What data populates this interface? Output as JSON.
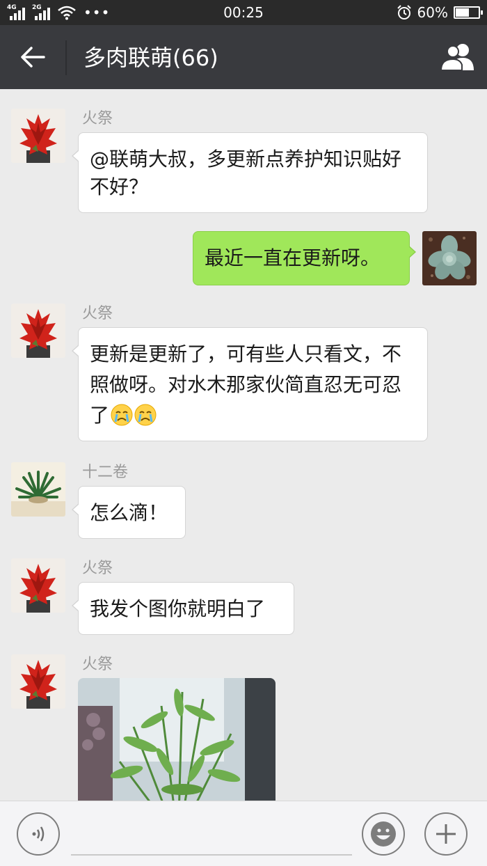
{
  "status_bar": {
    "network_1": "4G",
    "network_2": "2G",
    "more": "•••",
    "time": "00:25",
    "battery_text": "60%",
    "battery_level": 0.6
  },
  "header": {
    "title": "多肉联萌(66)",
    "back_icon": "back-arrow-icon",
    "members_icon": "group-members-icon"
  },
  "messages": [
    {
      "direction": "incoming",
      "sender": "火祭",
      "text": "@联萌大叔，多更新点养护知识贴好不好？"
    },
    {
      "direction": "outgoing",
      "text": "最近一直在更新呀。"
    },
    {
      "direction": "incoming",
      "sender": "火祭",
      "text": "更新是更新了，可有些人只看文，不照做呀。对水木那家伙简直忍无可忍了",
      "emojis": [
        "crying-face-emoji",
        "crying-face-emoji"
      ]
    },
    {
      "direction": "incoming",
      "sender": "十二卷",
      "text": "怎么滴！"
    },
    {
      "direction": "incoming",
      "sender": "火祭",
      "text": "我发个图你就明白了"
    },
    {
      "direction": "incoming",
      "sender": "火祭",
      "type": "image"
    }
  ],
  "input_bar": {
    "voice_icon": "voice-icon",
    "emoji_icon": "emoji-icon",
    "plus_icon": "plus-icon",
    "input_value": ""
  },
  "colors": {
    "header_bg": "#393a3e",
    "status_bar_bg": "#2a2a2a",
    "chat_bg": "#ebebeb",
    "outgoing_bubble": "#a0e75a",
    "incoming_bubble": "#ffffff",
    "sender_name": "#9a9a9a"
  }
}
